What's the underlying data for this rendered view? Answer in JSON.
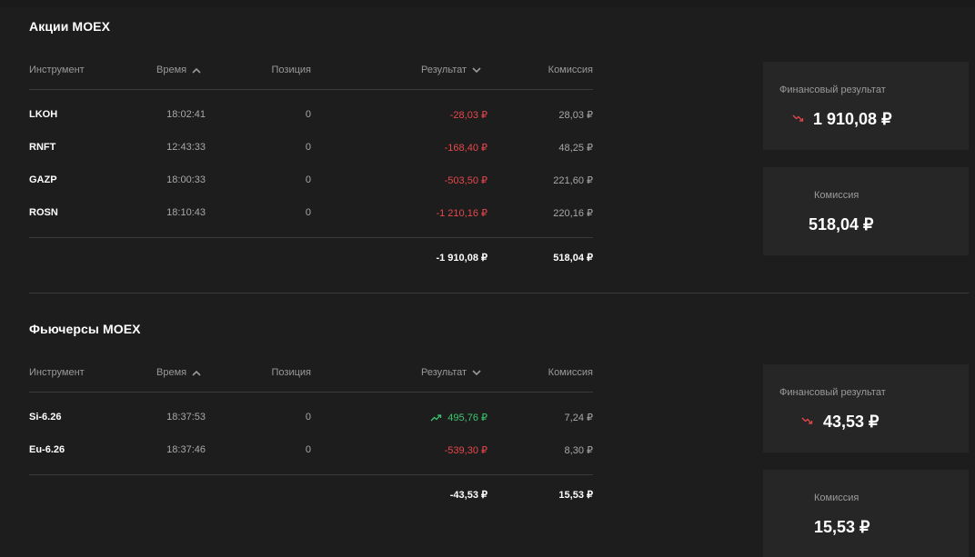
{
  "columns": {
    "instrument": "Инструмент",
    "time": "Время",
    "position": "Позиция",
    "result": "Результат",
    "commission": "Комиссия"
  },
  "sections": [
    {
      "title": "Акции MOEX",
      "rows": [
        {
          "ticker": "LKOH",
          "time": "18:02:41",
          "position": "0",
          "result": "-28,03 ₽",
          "commission": "28,03 ₽",
          "trend": "down"
        },
        {
          "ticker": "RNFT",
          "time": "12:43:33",
          "position": "0",
          "result": "-168,40 ₽",
          "commission": "48,25 ₽",
          "trend": "down"
        },
        {
          "ticker": "GAZP",
          "time": "18:00:33",
          "position": "0",
          "result": "-503,50 ₽",
          "commission": "221,60 ₽",
          "trend": "down"
        },
        {
          "ticker": "ROSN",
          "time": "18:10:43",
          "position": "0",
          "result": "-1 210,16 ₽",
          "commission": "220,16 ₽",
          "trend": "down"
        }
      ],
      "total_result": "-1 910,08 ₽",
      "total_commission": "518,04 ₽",
      "summary": {
        "result_label": "Финансовый результат",
        "result_value": "1 910,08 ₽",
        "result_trend": "down",
        "commission_label": "Комиссия",
        "commission_value": "518,04 ₽"
      }
    },
    {
      "title": "Фьючерсы MOEX",
      "rows": [
        {
          "ticker": "Si-6.26",
          "time": "18:37:53",
          "position": "0",
          "result": "495,76 ₽",
          "commission": "7,24 ₽",
          "trend": "up"
        },
        {
          "ticker": "Eu-6.26",
          "time": "18:37:46",
          "position": "0",
          "result": "-539,30 ₽",
          "commission": "8,30 ₽",
          "trend": "down"
        }
      ],
      "total_result": "-43,53 ₽",
      "total_commission": "15,53 ₽",
      "summary": {
        "result_label": "Финансовый результат",
        "result_value": "43,53 ₽",
        "result_trend": "down",
        "commission_label": "Комиссия",
        "commission_value": "15,53 ₽"
      }
    }
  ],
  "colors": {
    "background": "#1d1d1d",
    "card": "#262626",
    "negative": "#e8474b",
    "positive": "#3cc76e",
    "muted": "#9a9a9a"
  },
  "icons": {
    "sort_asc": "chevron-up-icon",
    "sort_desc": "chevron-down-icon",
    "trend_up": "trend-up-icon",
    "trend_down": "trend-down-icon"
  }
}
